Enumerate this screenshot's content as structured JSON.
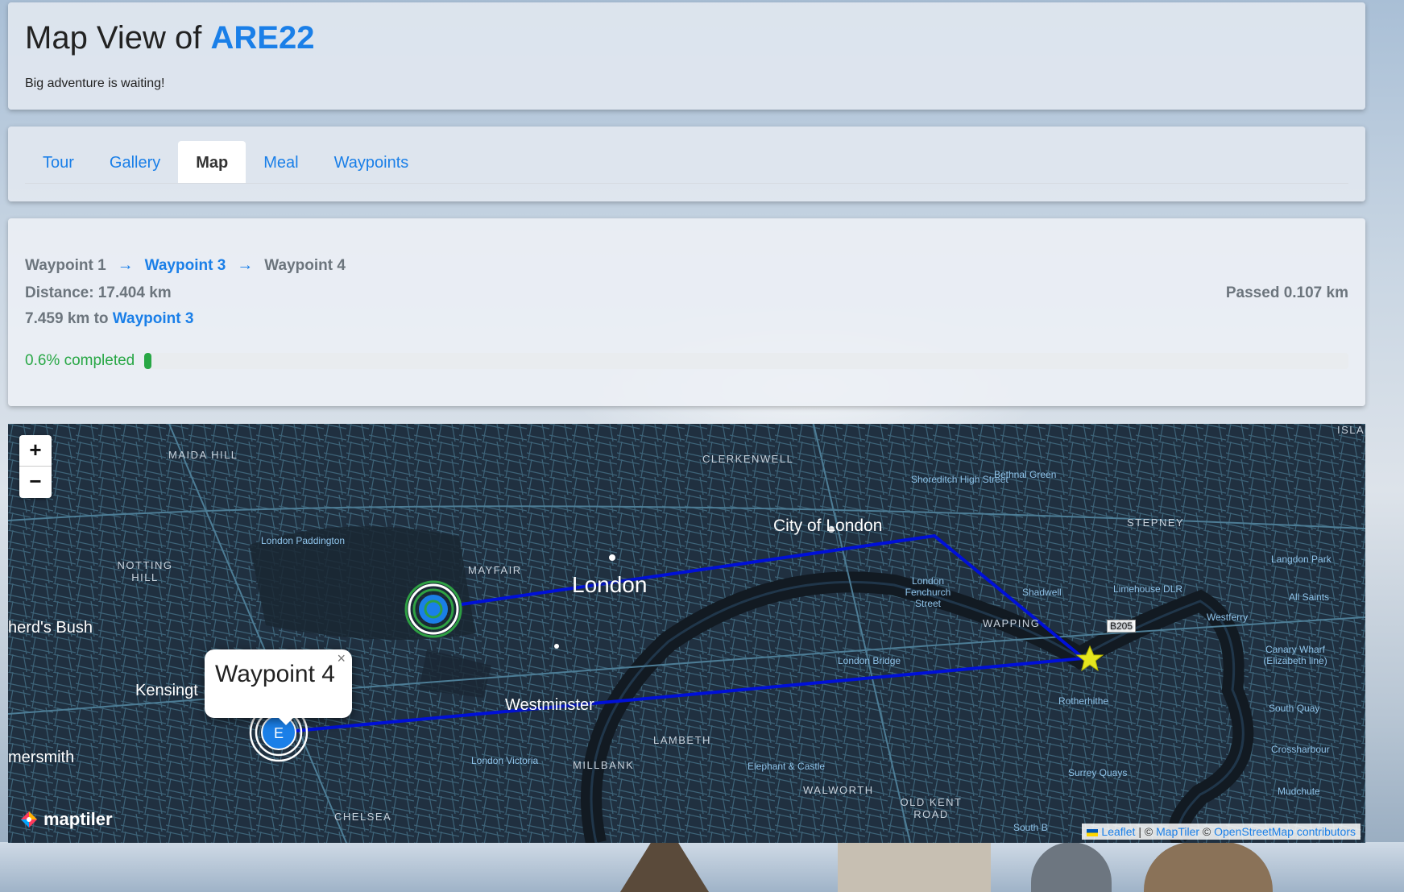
{
  "header": {
    "title_prefix": "Map View of",
    "title_accent": "ARE22",
    "subtitle": "Big adventure is waiting!"
  },
  "tabs": [
    {
      "label": "Tour",
      "active": false
    },
    {
      "label": "Gallery",
      "active": false
    },
    {
      "label": "Map",
      "active": true
    },
    {
      "label": "Meal",
      "active": false
    },
    {
      "label": "Waypoints",
      "active": false
    }
  ],
  "progress": {
    "route": {
      "from": "Waypoint 1",
      "via": "Waypoint 3",
      "to": "Waypoint 4"
    },
    "distance_text": "Distance: 17.404 km",
    "passed_text": "Passed 0.107 km",
    "to_next_prefix": "7.459 km to",
    "to_next_target": "Waypoint 3",
    "completed_text": "0.6% completed",
    "completed_fraction": 0.006,
    "bar_color": "#28a745"
  },
  "map": {
    "zoom_in": "+",
    "zoom_out": "−",
    "labels": {
      "maida_hill": "MAIDA HILL",
      "clerkenwell": "CLERKENWELL",
      "shoreditch": "Shoreditch High Street",
      "bethnal_green": "Bethnal Green",
      "stepney": "STEPNEY",
      "london_paddington": "London Paddington",
      "city_of_london": "City of London",
      "langdon_park": "Langdon Park",
      "notting_hill": "NOTTING HILL",
      "mayfair": "MAYFAIR",
      "london": "London",
      "london_fenchurch": "London Fenchurch Street",
      "shadwell": "Shadwell",
      "limehouse_dlr": "Limehouse DLR",
      "all_saints": "All Saints",
      "westferry": "Westferry",
      "shepherds_bush": "herd's Bush",
      "wapping": "WAPPING",
      "b205": "B205",
      "london_bridge": "London Bridge",
      "canary_wharf": "Canary Wharf (Elizabeth line)",
      "kensington": "Kensingt",
      "westminster": "Westminster",
      "rotherhithe": "Rotherhithe",
      "south_quay": "South Quay",
      "lambeth": "LAMBETH",
      "hammersmith": "mersmith",
      "london_victoria": "London Victoria",
      "millbank": "MILLBANK",
      "elephant_castle": "Elephant & Castle",
      "crossharbour": "Crossharbour",
      "surrey_quays": "Surrey Quays",
      "walworth": "WALWORTH",
      "mudchute": "Mudchute",
      "old_kent_road": "OLD KENT ROAD",
      "chelsea": "CHELSEA",
      "south_b": "South B",
      "isla": "ISLA"
    },
    "route_color": "#0010d8",
    "start_marker_label": "E",
    "popup_title": "Waypoint 4",
    "popup_close": "×",
    "logo_text": "maptiler",
    "attribution": {
      "leaflet": "Leaflet",
      "sep": " | © ",
      "maptiler": "MapTiler",
      "osm_prefix": " © ",
      "osm": "OpenStreetMap contributors"
    }
  }
}
